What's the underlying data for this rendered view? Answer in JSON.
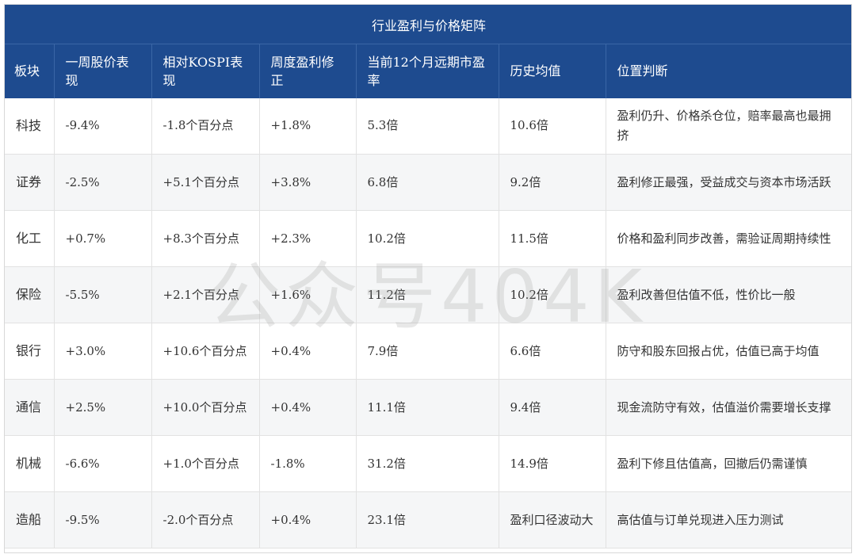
{
  "table": {
    "title": "行业盈利与价格矩阵",
    "columns": [
      "板块",
      "一周股价表现",
      "相对KOSPI表现",
      "周度盈利修正",
      "当前12个月远期市盈率",
      "历史均值",
      "位置判断"
    ],
    "rows": [
      [
        "科技",
        "-9.4%",
        "-1.8个百分点",
        "+1.8%",
        "5.3倍",
        "10.6倍",
        "盈利仍升、价格杀仓位，赔率最高也最拥挤"
      ],
      [
        "证券",
        "-2.5%",
        "+5.1个百分点",
        "+3.8%",
        "6.8倍",
        "9.2倍",
        "盈利修正最强，受益成交与资本市场活跃"
      ],
      [
        "化工",
        "+0.7%",
        "+8.3个百分点",
        "+2.3%",
        "10.2倍",
        "11.5倍",
        "价格和盈利同步改善，需验证周期持续性"
      ],
      [
        "保险",
        "-5.5%",
        "+2.1个百分点",
        "+1.6%",
        "11.2倍",
        "10.2倍",
        "盈利改善但估值不低，性价比一般"
      ],
      [
        "银行",
        "+3.0%",
        "+10.6个百分点",
        "+0.4%",
        "7.9倍",
        "6.6倍",
        "防守和股东回报占优，估值已高于均值"
      ],
      [
        "通信",
        "+2.5%",
        "+10.0个百分点",
        "+0.4%",
        "11.1倍",
        "9.4倍",
        "现金流防守有效，估值溢价需要增长支撑"
      ],
      [
        "机械",
        "-6.6%",
        "+1.0个百分点",
        "-1.8%",
        "31.2倍",
        "14.9倍",
        "盈利下修且估值高，回撤后仍需谨慎"
      ],
      [
        "造船",
        "-9.5%",
        "-2.0个百分点",
        "+0.4%",
        "23.1倍",
        "盈利口径波动大",
        "高估值与订单兑现进入压力测试"
      ]
    ]
  },
  "watermark": "公众号404K",
  "colors": {
    "header_bg": "#1e4b8f",
    "header_text": "#ffffff",
    "stripe": "#f5f6f7"
  }
}
